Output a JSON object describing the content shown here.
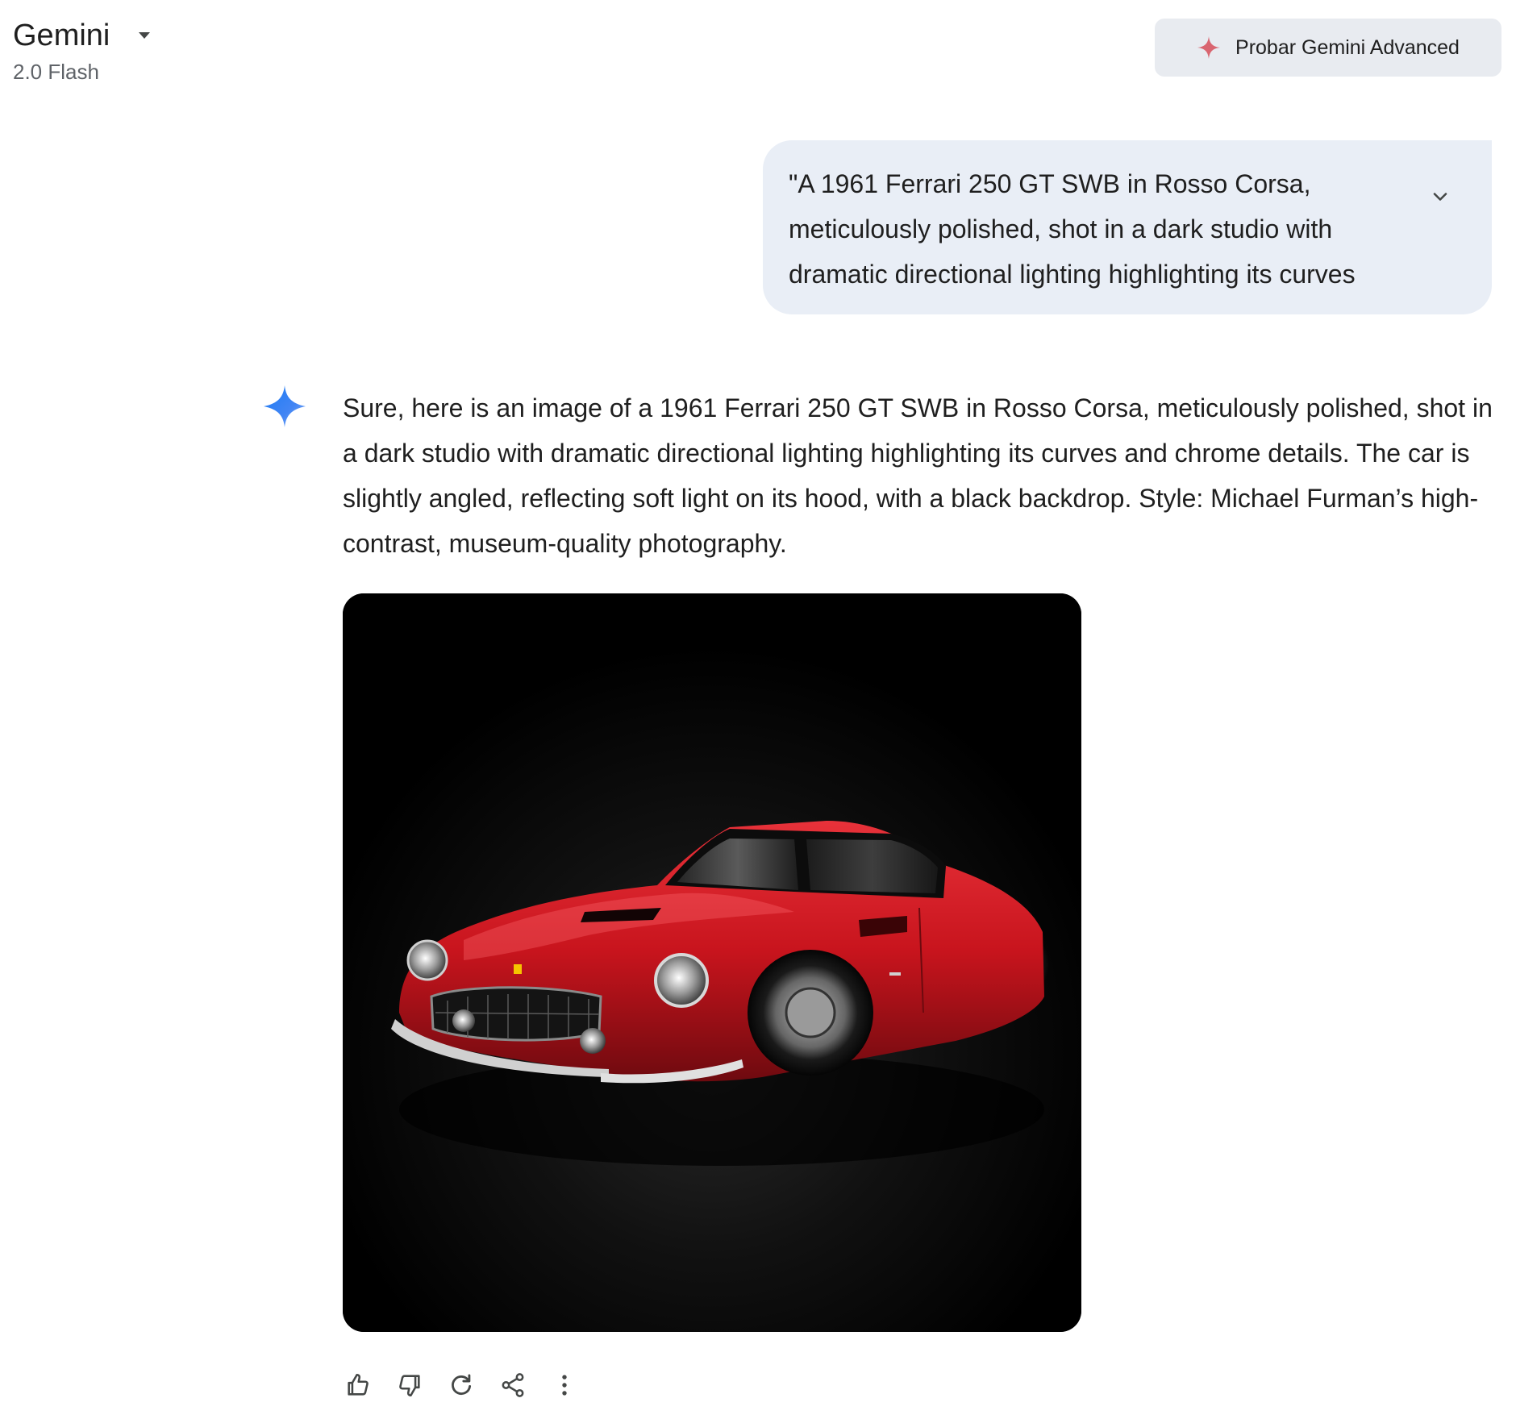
{
  "header": {
    "app_title": "Gemini",
    "model_version": "2.0 Flash",
    "upgrade_label": "Probar Gemini Advanced"
  },
  "conversation": {
    "user_prompt": "\"A 1961 Ferrari 250 GT SWB in Rosso Corsa, meticulously polished, shot in a dark studio with dramatic directional lighting highlighting its curves and chrome details. The...",
    "response_text": "Sure, here is an image of a 1961 Ferrari 250 GT SWB in Rosso Corsa, meticulously polished, shot in a dark studio with dramatic directional lighting highlighting its curves and chrome details. The car is slightly angled, reflecting soft light on its hood, with a black backdrop. Style: Michael Furman’s high-contrast, museum-quality photography."
  },
  "icons": {
    "model_caret": "caret-down-icon",
    "upgrade": "spark-icon",
    "expand_prompt": "chevron-down-icon",
    "assistant": "gemini-sparkle-icon",
    "actions": [
      "thumb-up-icon",
      "thumb-down-icon",
      "redo-icon",
      "share-icon",
      "more-vert-icon"
    ]
  },
  "colors": {
    "bubble_bg": "#e9eef6",
    "upgrade_bg": "#e8ebf0",
    "upgrade_spark": "#d96570",
    "gemini_blue": "#4285f4",
    "car_red": "#c8141d",
    "text_primary": "#1f1f1f",
    "text_secondary": "#5f6368"
  }
}
